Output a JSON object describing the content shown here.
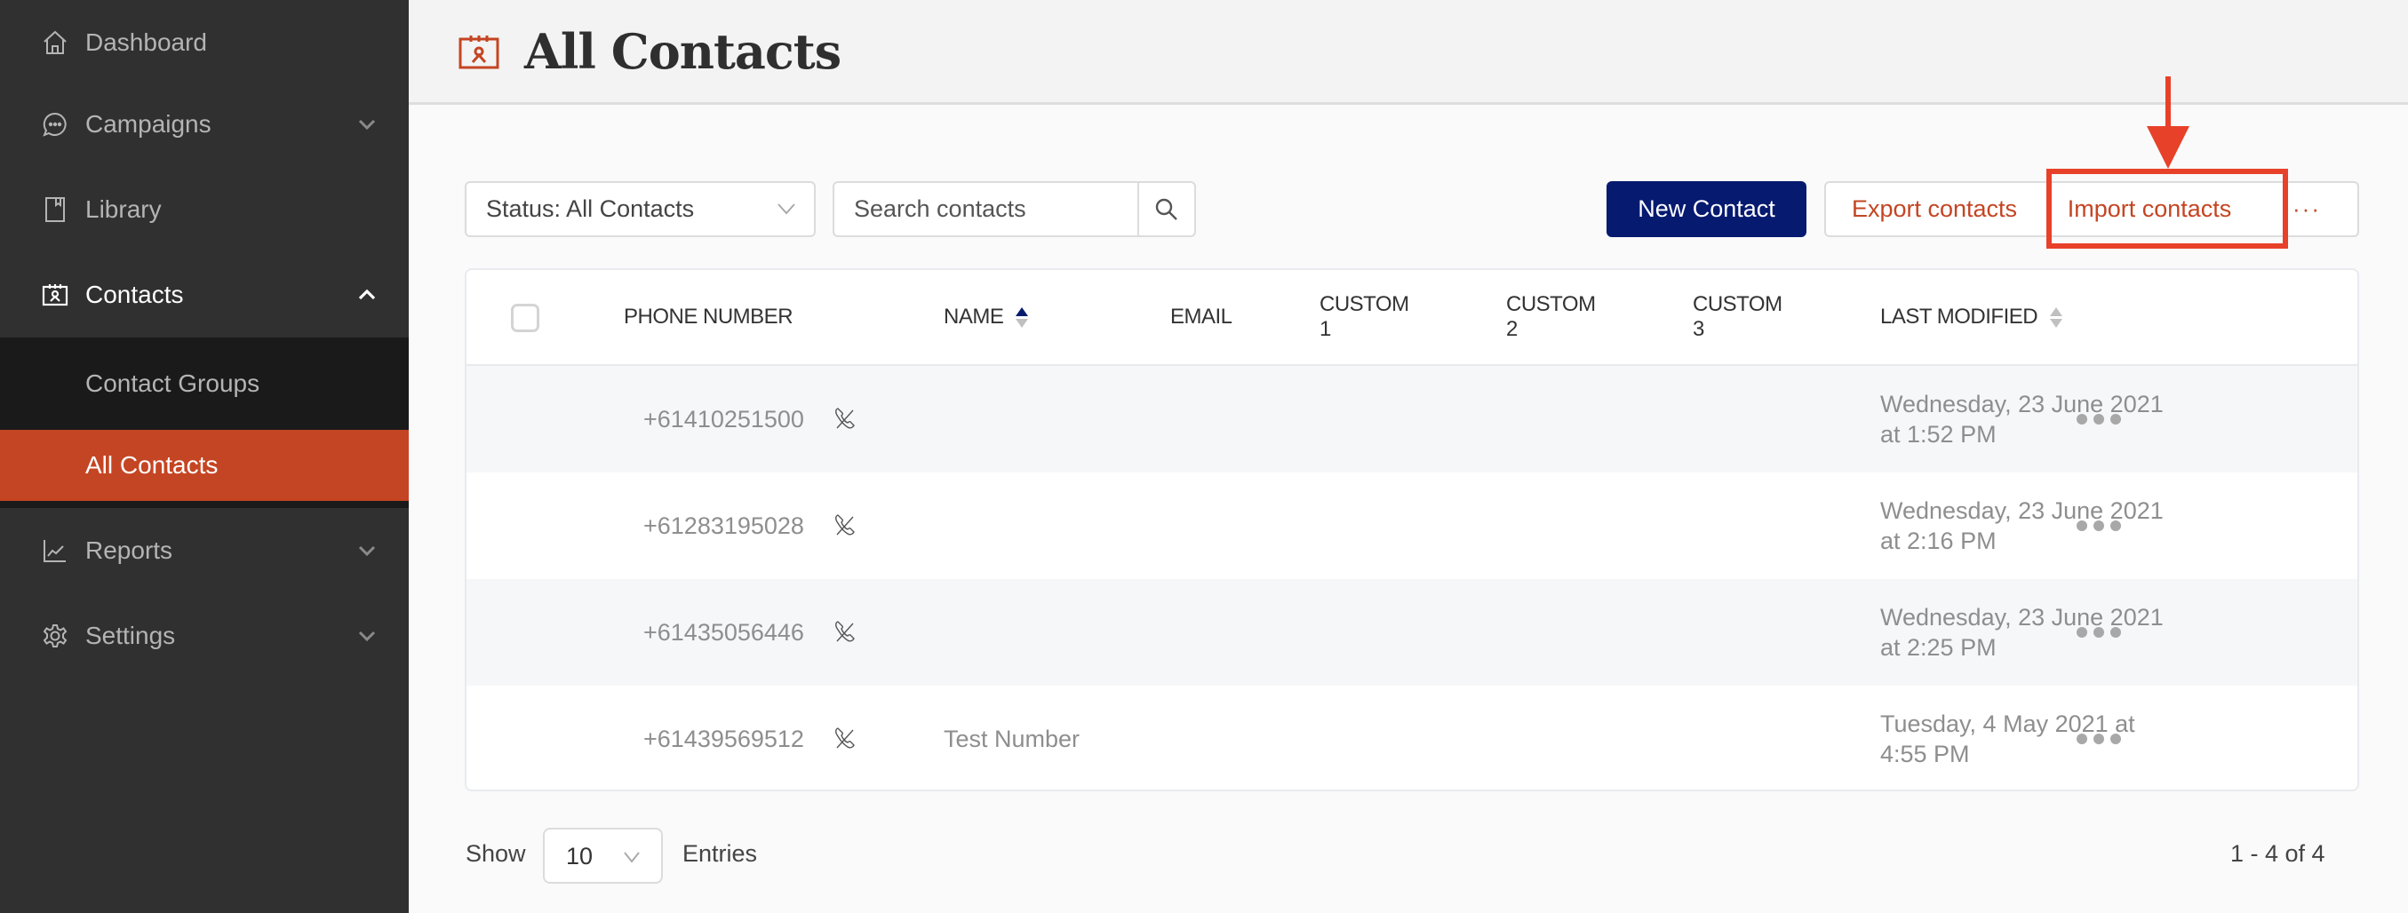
{
  "sidebar": {
    "items": [
      {
        "label": "Dashboard",
        "icon": "home-icon"
      },
      {
        "label": "Campaigns",
        "icon": "chat-bubble-icon",
        "expandable": true
      },
      {
        "label": "Library",
        "icon": "bookmark-book-icon"
      },
      {
        "label": "Contacts",
        "icon": "contacts-card-icon",
        "expandable": true,
        "expanded": true
      },
      {
        "label": "Reports",
        "icon": "line-chart-icon",
        "expandable": true
      },
      {
        "label": "Settings",
        "icon": "gear-icon",
        "expandable": true
      }
    ],
    "contacts_subitems": [
      {
        "label": "Contact Groups",
        "active": false
      },
      {
        "label": "All Contacts",
        "active": true
      }
    ]
  },
  "header": {
    "title": "All Contacts",
    "icon": "contacts-card-icon"
  },
  "toolbar": {
    "status_filter": "Status: All Contacts",
    "search_placeholder": "Search contacts",
    "new_contact_label": "New Contact",
    "export_label": "Export contacts",
    "import_label": "Import contacts",
    "more_label": "···"
  },
  "table": {
    "columns": [
      "PHONE NUMBER",
      "NAME",
      "EMAIL",
      "CUSTOM 1",
      "CUSTOM 2",
      "CUSTOM 3",
      "LAST MODIFIED"
    ],
    "header": {
      "phone": "PHONE NUMBER",
      "name": "NAME",
      "email": "EMAIL",
      "custom1_a": "CUSTOM",
      "custom1_b": "1",
      "custom2_a": "CUSTOM",
      "custom2_b": "2",
      "custom3_a": "CUSTOM",
      "custom3_b": "3",
      "modified": "LAST MODIFIED"
    },
    "sort": {
      "column": "NAME",
      "direction": "ascending"
    },
    "rows": [
      {
        "phone": "+61410251500",
        "name": "",
        "email": "",
        "custom1": "",
        "custom2": "",
        "custom3": "",
        "modified": "Wednesday, 23 June 2021 at 1:52 PM"
      },
      {
        "phone": "+61283195028",
        "name": "",
        "email": "",
        "custom1": "",
        "custom2": "",
        "custom3": "",
        "modified": "Wednesday, 23 June 2021 at 2:16 PM"
      },
      {
        "phone": "+61435056446",
        "name": "",
        "email": "",
        "custom1": "",
        "custom2": "",
        "custom3": "",
        "modified": "Wednesday, 23 June 2021 at 2:25 PM"
      },
      {
        "phone": "+61439569512",
        "name": "Test Number",
        "email": "",
        "custom1": "",
        "custom2": "",
        "custom3": "",
        "modified": "Tuesday, 4 May 2021 at 4:55 PM"
      }
    ]
  },
  "footer": {
    "show_label": "Show",
    "entries_value": "10",
    "entries_label": "Entries",
    "pagination": "1 - 4 of 4"
  },
  "colors": {
    "sidebar_bg": "#303030",
    "subnav_bg": "#1a1a1a",
    "accent": "#c44523",
    "primary_button": "#061a70",
    "annotation": "#e8412a"
  }
}
